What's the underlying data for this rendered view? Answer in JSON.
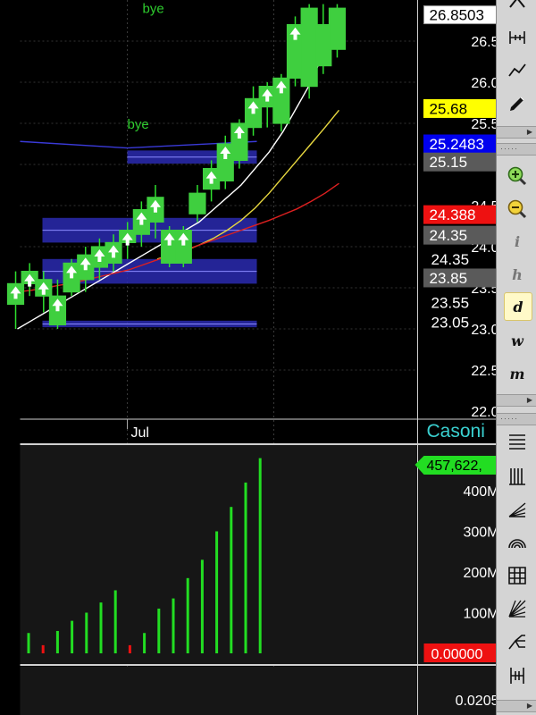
{
  "chart_data": [
    {
      "type": "candlestick",
      "title": "",
      "ylim": [
        22.0,
        26.8
      ],
      "y_ticks": [
        "26.5",
        "26.0",
        "25.5",
        "25.0",
        "24.5",
        "24.0",
        "23.5",
        "23.0",
        "22.5",
        "22.0"
      ],
      "x_tick_labels": [
        "Jul"
      ],
      "candles": [
        {
          "o": 23.3,
          "h": 23.7,
          "l": 23.0,
          "c": 23.55
        },
        {
          "o": 23.55,
          "h": 23.8,
          "l": 23.4,
          "c": 23.7
        },
        {
          "o": 23.4,
          "h": 23.7,
          "l": 23.2,
          "c": 23.6
        },
        {
          "o": 23.05,
          "h": 23.6,
          "l": 23.0,
          "c": 23.4
        },
        {
          "o": 23.45,
          "h": 23.85,
          "l": 23.4,
          "c": 23.8
        },
        {
          "o": 23.6,
          "h": 24.0,
          "l": 23.45,
          "c": 23.9
        },
        {
          "o": 23.75,
          "h": 24.1,
          "l": 23.6,
          "c": 24.0
        },
        {
          "o": 23.8,
          "h": 24.15,
          "l": 23.7,
          "c": 24.05
        },
        {
          "o": 24.05,
          "h": 24.3,
          "l": 23.85,
          "c": 24.2
        },
        {
          "o": 24.15,
          "h": 24.55,
          "l": 24.0,
          "c": 24.45
        },
        {
          "o": 24.3,
          "h": 24.75,
          "l": 24.1,
          "c": 24.6
        },
        {
          "o": 23.8,
          "h": 24.25,
          "l": 23.75,
          "c": 24.2
        },
        {
          "o": 23.8,
          "h": 24.25,
          "l": 23.75,
          "c": 24.2
        },
        {
          "o": 24.4,
          "h": 24.75,
          "l": 24.3,
          "c": 24.65
        },
        {
          "o": 24.7,
          "h": 25.05,
          "l": 24.55,
          "c": 24.95
        },
        {
          "o": 24.8,
          "h": 25.35,
          "l": 24.7,
          "c": 25.25
        },
        {
          "o": 25.05,
          "h": 25.55,
          "l": 24.95,
          "c": 25.5
        },
        {
          "o": 25.45,
          "h": 25.95,
          "l": 25.35,
          "c": 25.8
        },
        {
          "o": 25.7,
          "h": 26.0,
          "l": 25.45,
          "c": 25.95
        },
        {
          "o": 25.5,
          "h": 26.1,
          "l": 25.4,
          "c": 26.05
        },
        {
          "o": 26.05,
          "h": 26.8,
          "l": 25.95,
          "c": 26.7
        },
        {
          "o": 25.95,
          "h": 26.95,
          "l": 25.8,
          "c": 26.9
        },
        {
          "o": 26.2,
          "h": 26.95,
          "l": 26.1,
          "c": 26.7
        },
        {
          "o": 26.4,
          "h": 26.95,
          "l": 26.3,
          "c": 26.9
        }
      ],
      "buy_signals": [
        0,
        1,
        2,
        3,
        4,
        5,
        6,
        7,
        8,
        9,
        10,
        11,
        12,
        14,
        15,
        16,
        17,
        18,
        19,
        20
      ],
      "signal_labels": [
        {
          "text": "bye",
          "price": 26.82,
          "color": "#2ecc2e"
        },
        {
          "text": "bye",
          "price": 25.48,
          "color": "#2ecc2e"
        }
      ],
      "zones": [
        {
          "top": 25.17,
          "bottom": 25.01,
          "color": "#2a2ab0"
        },
        {
          "top": 24.35,
          "bottom": 24.05,
          "color": "#2a2ab0"
        },
        {
          "top": 23.85,
          "bottom": 23.55,
          "color": "#2a2ab0"
        },
        {
          "top": 23.1,
          "bottom": 23.02,
          "color": "#2a2ab0"
        }
      ],
      "series": [
        {
          "color": "#ffffff",
          "values": [
            23.0,
            23.1,
            23.2,
            23.3,
            23.4,
            23.5,
            23.6,
            23.7,
            23.8,
            23.9,
            24.0,
            24.1,
            24.2,
            24.3,
            24.45,
            24.6,
            24.75,
            24.95,
            25.15,
            25.4,
            25.7,
            26.0,
            26.4,
            26.9
          ]
        },
        {
          "color": "#e8d840",
          "values": [
            null,
            null,
            null,
            null,
            null,
            null,
            null,
            null,
            null,
            null,
            23.85,
            23.9,
            23.95,
            24.02,
            24.1,
            24.2,
            24.32,
            24.47,
            24.65,
            24.85,
            25.05,
            25.25,
            25.45,
            25.66
          ]
        },
        {
          "color": "#dd2020",
          "values": [
            23.45,
            23.47,
            23.5,
            23.53,
            23.56,
            23.6,
            23.64,
            23.68,
            23.72,
            23.78,
            23.84,
            23.9,
            23.96,
            24.02,
            24.08,
            24.14,
            24.2,
            24.26,
            24.32,
            24.39,
            24.46,
            24.55,
            24.65,
            24.77
          ]
        },
        {
          "color": "#3a3ad8",
          "values": [
            25.28,
            25.27,
            25.26,
            25.25,
            25.24,
            25.23,
            25.22,
            25.21,
            25.21,
            25.2,
            25.2,
            25.2,
            25.2,
            25.2,
            25.21,
            25.21,
            25.22,
            25.22,
            25.23,
            25.24,
            25.25,
            25.26,
            25.27,
            25.28
          ]
        }
      ],
      "price_labels": [
        {
          "text": "26.8503",
          "price": 26.82,
          "bg": "#ffffff",
          "fg": "#000000"
        },
        {
          "text": "25.68",
          "price": 25.68,
          "bg": "#ffff00",
          "fg": "#000000"
        },
        {
          "text": "25.2483",
          "price": 25.25,
          "bg": "#0000ee",
          "fg": "#ffffff"
        },
        {
          "text": "25.15",
          "price": 25.03,
          "bg": "#5a5a5a",
          "fg": "#ffffff"
        },
        {
          "text": "24.388",
          "price": 24.39,
          "bg": "#ee1111",
          "fg": "#ffffff"
        },
        {
          "text": "24.35",
          "price": 24.14,
          "bg": "#5a5a5a",
          "fg": "#ffffff"
        },
        {
          "text": "24.35",
          "price": 23.85,
          "bg": "none",
          "fg": "#ffffff"
        },
        {
          "text": "23.85",
          "price": 23.62,
          "bg": "#5a5a5a",
          "fg": "#ffffff"
        },
        {
          "text": "23.55",
          "price": 23.32,
          "bg": "none",
          "fg": "#ffffff"
        },
        {
          "text": "23.05",
          "price": 23.08,
          "bg": "none",
          "fg": "#ffffff"
        }
      ],
      "watermark": "Casoni"
    },
    {
      "type": "bar",
      "y_ticks": [
        "400M",
        "300M",
        "200M",
        "100M"
      ],
      "ylim": [
        0,
        470
      ],
      "values": [
        50,
        20,
        55,
        80,
        100,
        125,
        155,
        20,
        50,
        110,
        135,
        185,
        230,
        300,
        360,
        420,
        480
      ],
      "colors": [
        "#22dd22",
        "#ee1111",
        "#22dd22",
        "#22dd22",
        "#22dd22",
        "#22dd22",
        "#22dd22",
        "#ee1111",
        "#22dd22",
        "#22dd22",
        "#22dd22",
        "#22dd22",
        "#22dd22",
        "#22dd22",
        "#22dd22",
        "#22dd22",
        "#22dd22"
      ],
      "latest_label": "457,622,",
      "zero_label": "0.00000"
    },
    {
      "type": "line",
      "y_ticks": [
        "0.0205"
      ],
      "values": []
    }
  ],
  "toolbar": {
    "letters": [
      "i",
      "h",
      "d",
      "w",
      "m"
    ],
    "selected_letter": "d"
  }
}
